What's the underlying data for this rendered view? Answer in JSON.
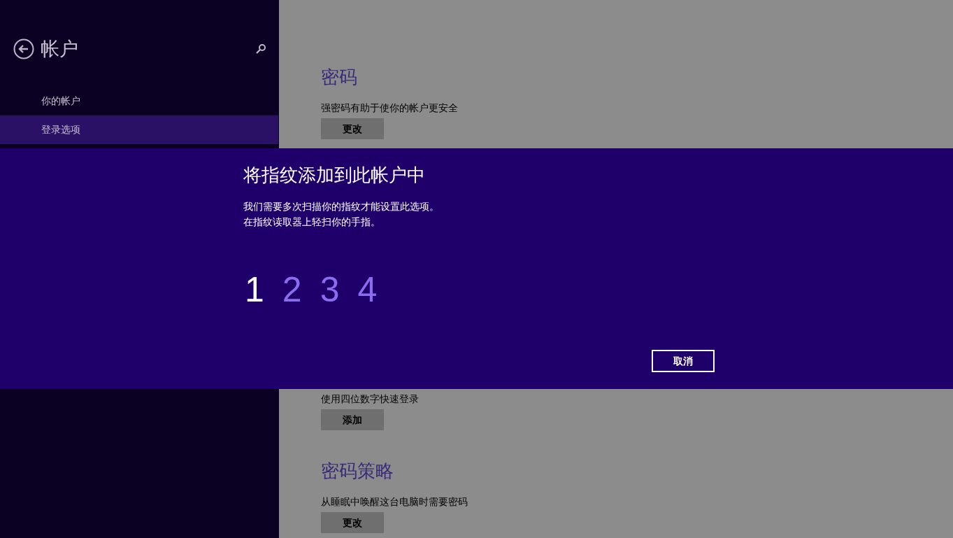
{
  "sidebar": {
    "title": "帐户",
    "items": [
      {
        "label": "你的帐户",
        "selected": false
      },
      {
        "label": "登录选项",
        "selected": true
      }
    ]
  },
  "sections": [
    {
      "heading": "密码",
      "description": "强密码有助于使你的帐户更安全",
      "button": "更改"
    },
    {
      "description": "使用四位数字快速登录",
      "button": "添加"
    },
    {
      "heading": "密码策略",
      "description": "从睡眠中唤醒这台电脑时需要密码",
      "button": "更改"
    }
  ],
  "dialog": {
    "title": "将指纹添加到此帐户中",
    "lines": [
      "我们需要多次扫描你的指纹才能设置此选项。",
      "在指纹读取器上轻扫你的手指。"
    ],
    "steps": [
      {
        "label": "1",
        "active": true
      },
      {
        "label": "2",
        "active": false
      },
      {
        "label": "3",
        "active": false
      },
      {
        "label": "4",
        "active": false
      }
    ],
    "cancel": "取消"
  }
}
